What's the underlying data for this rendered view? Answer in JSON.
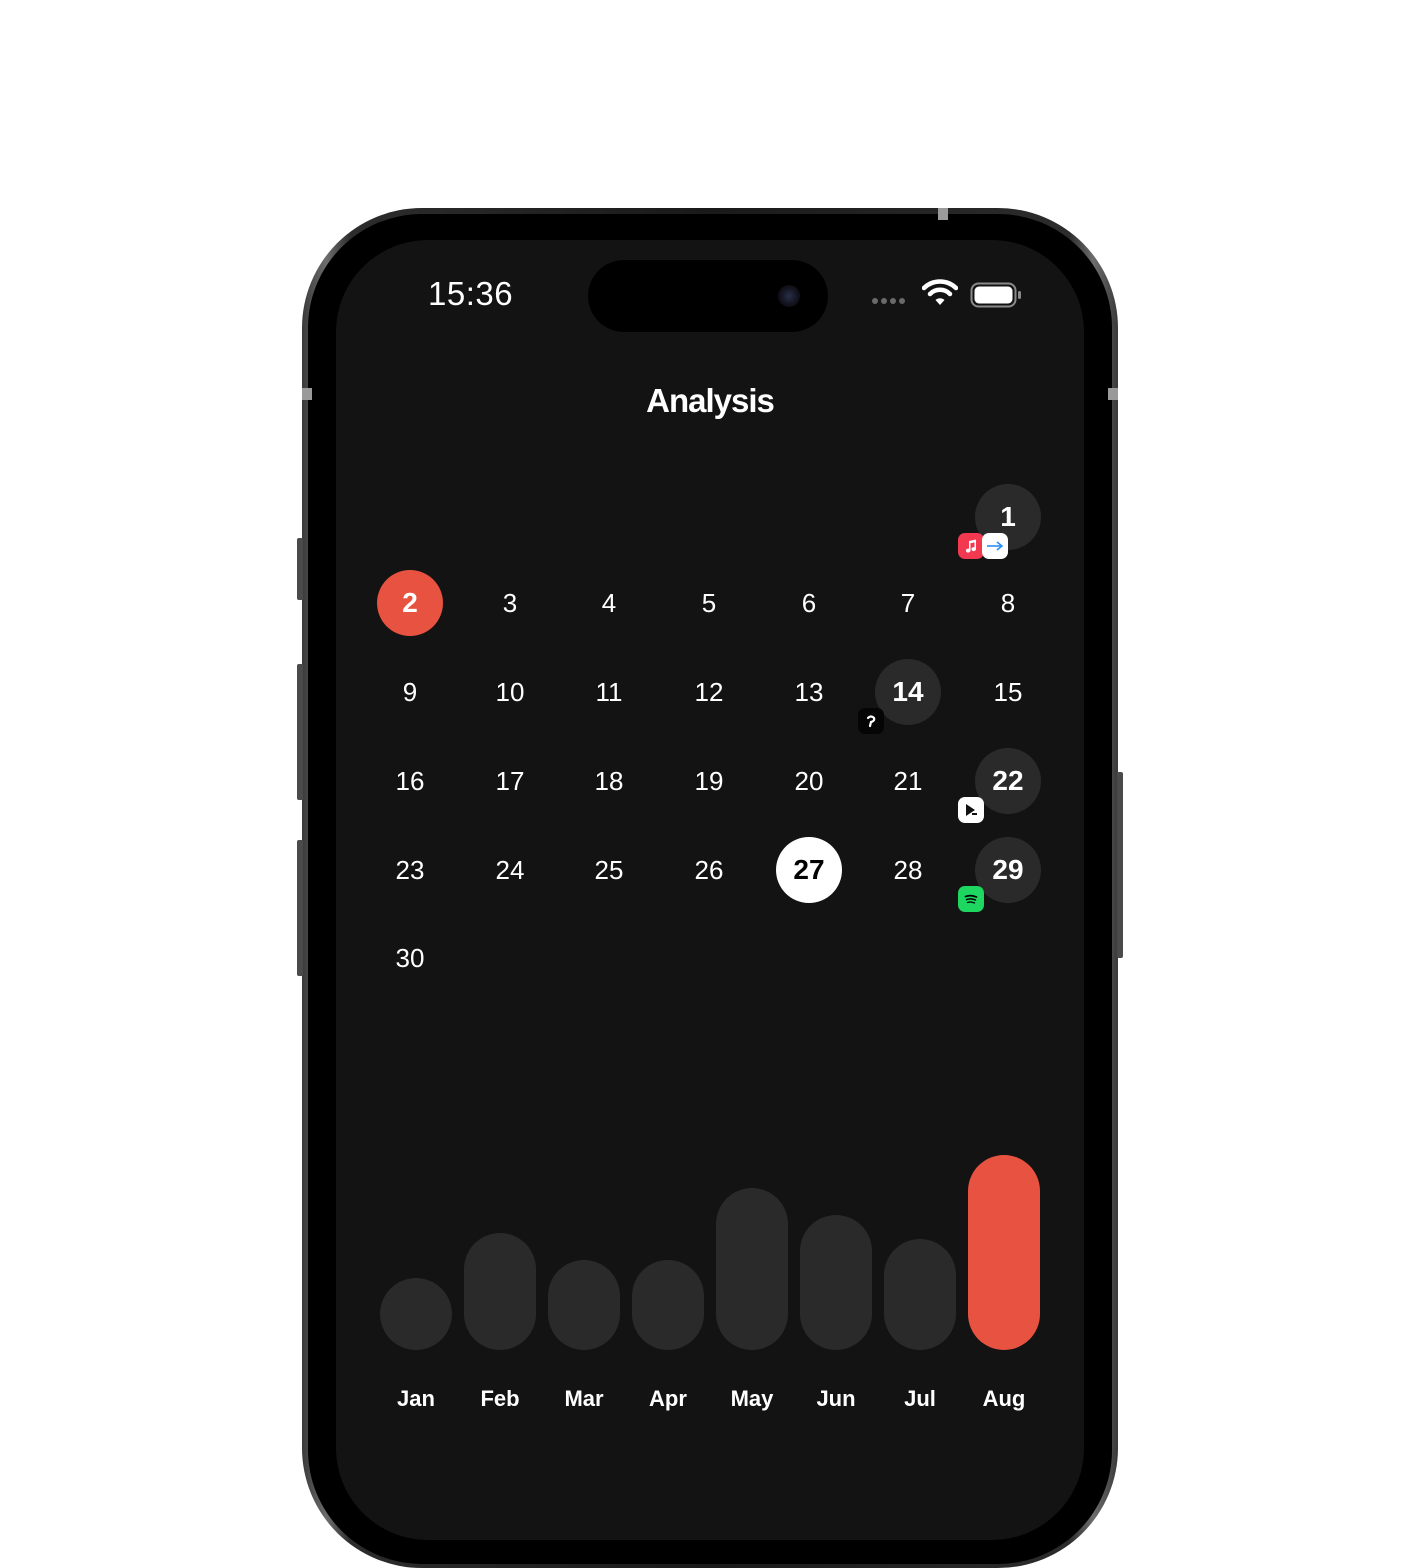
{
  "status_bar": {
    "time": "15:36"
  },
  "header": {
    "title": "Analysis"
  },
  "calendar": {
    "days": [
      {
        "label": "1",
        "state": "logged",
        "apps": [
          "music-app-icon",
          "share-app-icon"
        ]
      },
      {
        "label": "2",
        "state": "first"
      },
      {
        "label": "3"
      },
      {
        "label": "4"
      },
      {
        "label": "5"
      },
      {
        "label": "6"
      },
      {
        "label": "7"
      },
      {
        "label": "8"
      },
      {
        "label": "9"
      },
      {
        "label": "10"
      },
      {
        "label": "11"
      },
      {
        "label": "12"
      },
      {
        "label": "13"
      },
      {
        "label": "14",
        "state": "logged",
        "apps": [
          "audio-app-icon"
        ]
      },
      {
        "label": "15"
      },
      {
        "label": "16"
      },
      {
        "label": "17"
      },
      {
        "label": "18"
      },
      {
        "label": "19"
      },
      {
        "label": "20"
      },
      {
        "label": "21"
      },
      {
        "label": "22",
        "state": "logged",
        "apps": [
          "media-player-app-icon"
        ]
      },
      {
        "label": "23"
      },
      {
        "label": "24"
      },
      {
        "label": "25"
      },
      {
        "label": "26"
      },
      {
        "label": "27",
        "state": "today"
      },
      {
        "label": "28"
      },
      {
        "label": "29",
        "state": "logged",
        "apps": [
          "spotify-app-icon"
        ]
      },
      {
        "label": "30"
      }
    ]
  },
  "monthly_usage": {
    "months": [
      "Jan",
      "Feb",
      "Mar",
      "Apr",
      "May",
      "Jun",
      "Jul",
      "Aug"
    ],
    "relative_values": [
      0.37,
      0.6,
      0.46,
      0.46,
      0.83,
      0.69,
      0.57,
      1.0
    ],
    "highlighted_month": "Aug"
  },
  "colors": {
    "accent": "#e85240",
    "bar": "#2a2a2a",
    "screen_bg": "#131313",
    "text": "#ffffff"
  }
}
